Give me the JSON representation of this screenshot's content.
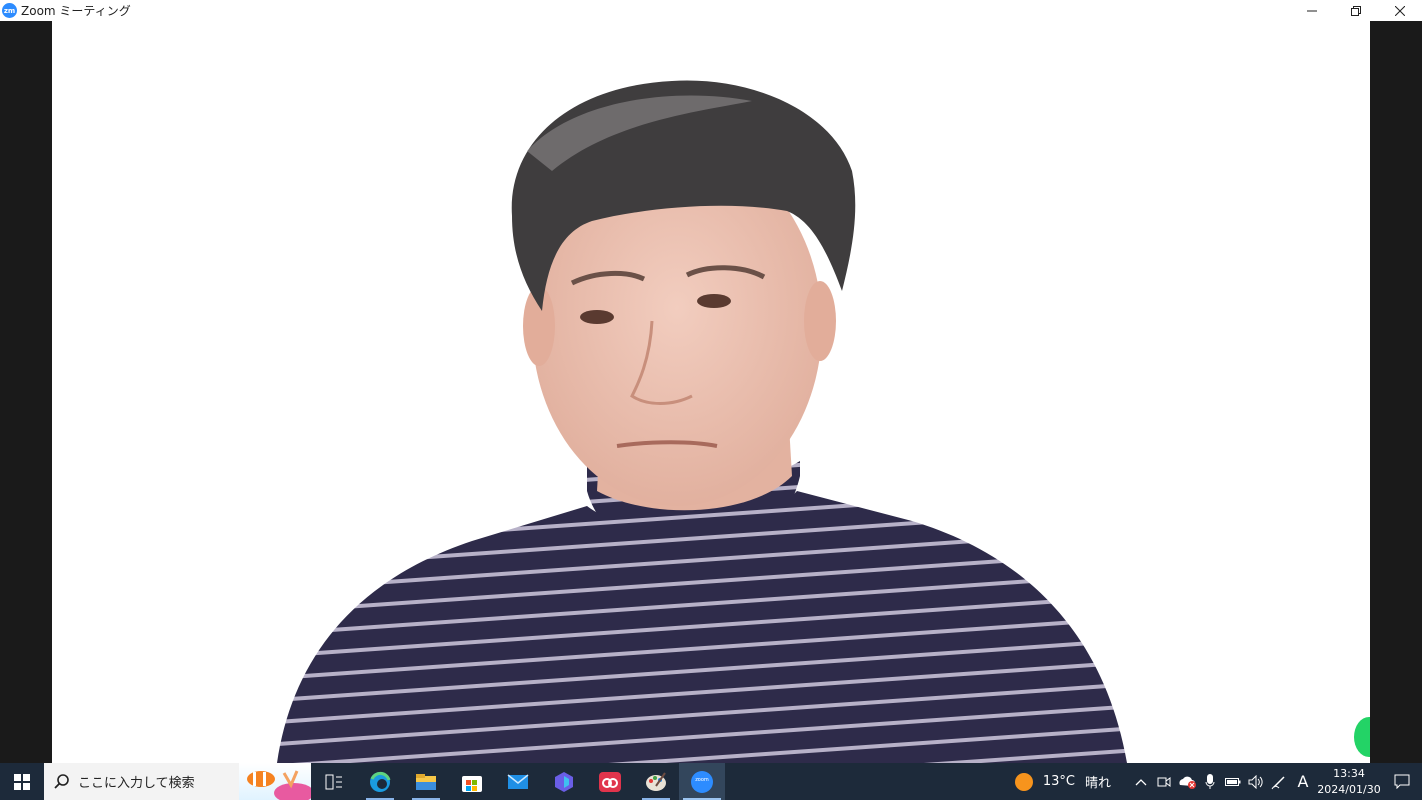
{
  "window": {
    "logo_text": "zm",
    "title": "Zoom ミーティング"
  },
  "colors": {
    "zoom_blue": "#2d8cff",
    "taskbar": "#1d2a3a",
    "video_bg": "#ffffff",
    "side_bg": "#1a1a1a"
  },
  "taskbar": {
    "search_placeholder": "ここに入力して検索",
    "pinned": [
      {
        "name": "task-view-icon"
      },
      {
        "name": "edge-icon"
      },
      {
        "name": "file-explorer-icon"
      },
      {
        "name": "microsoft-store-icon"
      },
      {
        "name": "mail-icon"
      },
      {
        "name": "copilot-icon"
      },
      {
        "name": "creative-cloud-icon"
      },
      {
        "name": "paint-icon"
      },
      {
        "name": "zoom-icon",
        "label": "zoom",
        "active": true
      }
    ],
    "weather": {
      "temp": "13°C",
      "condition": "晴れ"
    },
    "ime": "A",
    "clock": {
      "time": "13:34",
      "date": "2024/01/30"
    }
  }
}
